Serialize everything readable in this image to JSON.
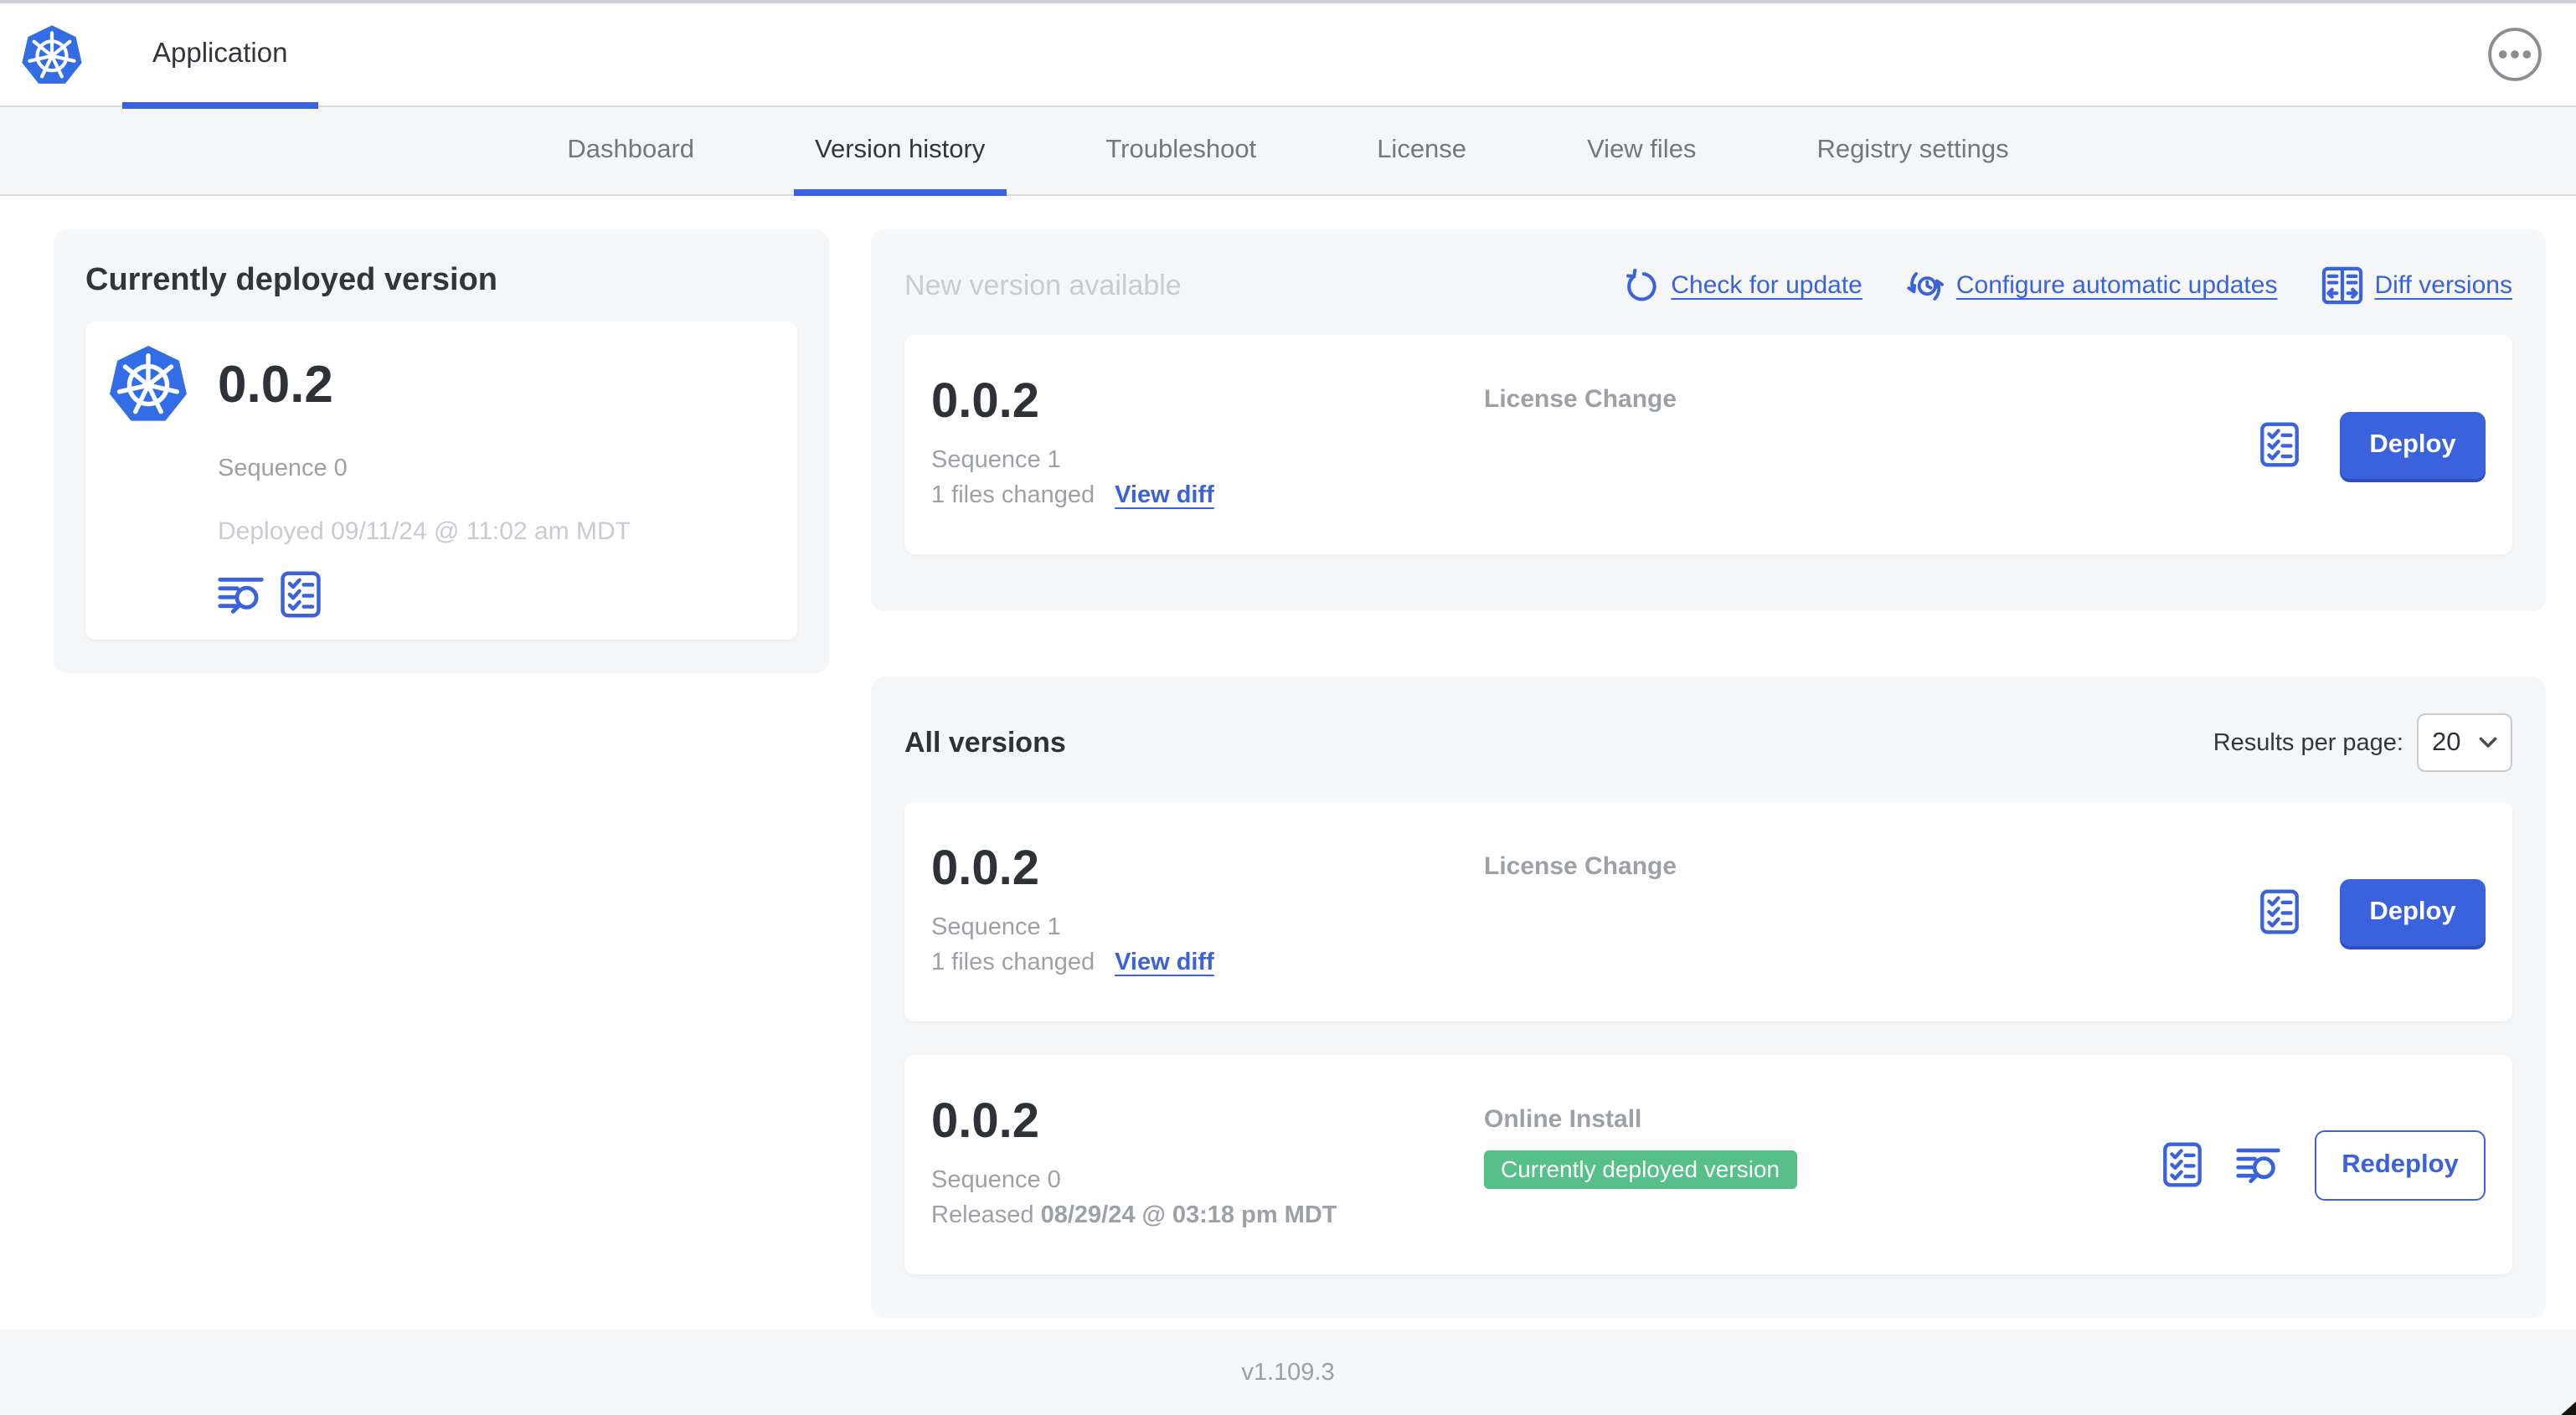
{
  "topbar": {
    "app_name": "Application"
  },
  "nav": {
    "items": [
      {
        "label": "Dashboard"
      },
      {
        "label": "Version history"
      },
      {
        "label": "Troubleshoot"
      },
      {
        "label": "License"
      },
      {
        "label": "View files"
      },
      {
        "label": "Registry settings"
      }
    ],
    "active": "Version history"
  },
  "current": {
    "title": "Currently deployed version",
    "version": "0.0.2",
    "sequence": "Sequence 0",
    "deployed": "Deployed 09/11/24 @ 11:02 am MDT"
  },
  "new_version": {
    "heading": "New version available",
    "check_for_update_label": "Check for update",
    "configure_automatic_updates_label": "Configure automatic updates",
    "diff_versions_label": "Diff versions",
    "row": {
      "version": "0.0.2",
      "sequence": "Sequence 1",
      "files_changed": "1 files changed",
      "view_diff_label": "View diff",
      "source": "License Change",
      "deploy_label": "Deploy"
    }
  },
  "all_versions": {
    "title": "All versions",
    "results_per_page_label": "Results per page:",
    "results_per_page_value": "20",
    "row1": {
      "version": "0.0.2",
      "sequence": "Sequence 1",
      "files_changed": "1 files changed",
      "view_diff_label": "View diff",
      "source": "License Change",
      "deploy_label": "Deploy"
    },
    "row2": {
      "version": "0.0.2",
      "sequence": "Sequence 0",
      "released_prefix": "Released",
      "released_date": "08/29/24 @ 03:18 pm MDT",
      "source": "Online Install",
      "badge_label": "Currently deployed version",
      "redeploy_label": "Redeploy"
    }
  },
  "footer": {
    "app_version": "v1.109.3"
  },
  "colors": {
    "primary_blue": "#3b62dd",
    "badge_green": "#56bf8a",
    "panel_gray": "#f4f6f8",
    "muted_text": "#9da1a5",
    "faint_text": "#c8ccd0"
  },
  "icons": {
    "app_logo": "kubernetes-wheel",
    "menu": "ellipsis-circle",
    "check_for_update": "refresh-circle-arrow",
    "configure_automatic_updates": "clock-sync-arrows",
    "diff_versions": "split-columns-arrows",
    "logs": "lines-with-magnifier",
    "preflight": "checklist-box",
    "select_chevron": "chevron-down"
  }
}
